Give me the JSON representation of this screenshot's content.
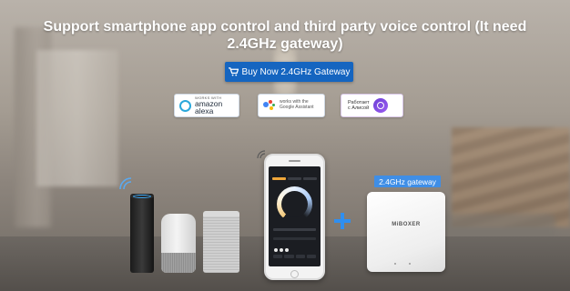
{
  "headline": "Support smartphone app control and third party voice control (It need 2.4GHz gateway)",
  "buy_button": {
    "label": "Buy Now 2.4GHz Gateway",
    "icon": "cart-icon",
    "color": "#1565c0"
  },
  "voice_badges": [
    {
      "small": "WORKS WITH",
      "big": "amazon alexa",
      "icon": "alexa-ring-icon"
    },
    {
      "line1": "works with the",
      "line2": "Google Assistant",
      "icon": "google-assistant-icon"
    },
    {
      "line1": "Работает",
      "line2": "с Алисой",
      "icon": "alice-icon"
    }
  ],
  "gateway": {
    "label": "2.4GHz gateway",
    "brand": "MiBOXER"
  },
  "colors": {
    "accent": "#3f8ee6",
    "plus": "#2f8ff0"
  }
}
